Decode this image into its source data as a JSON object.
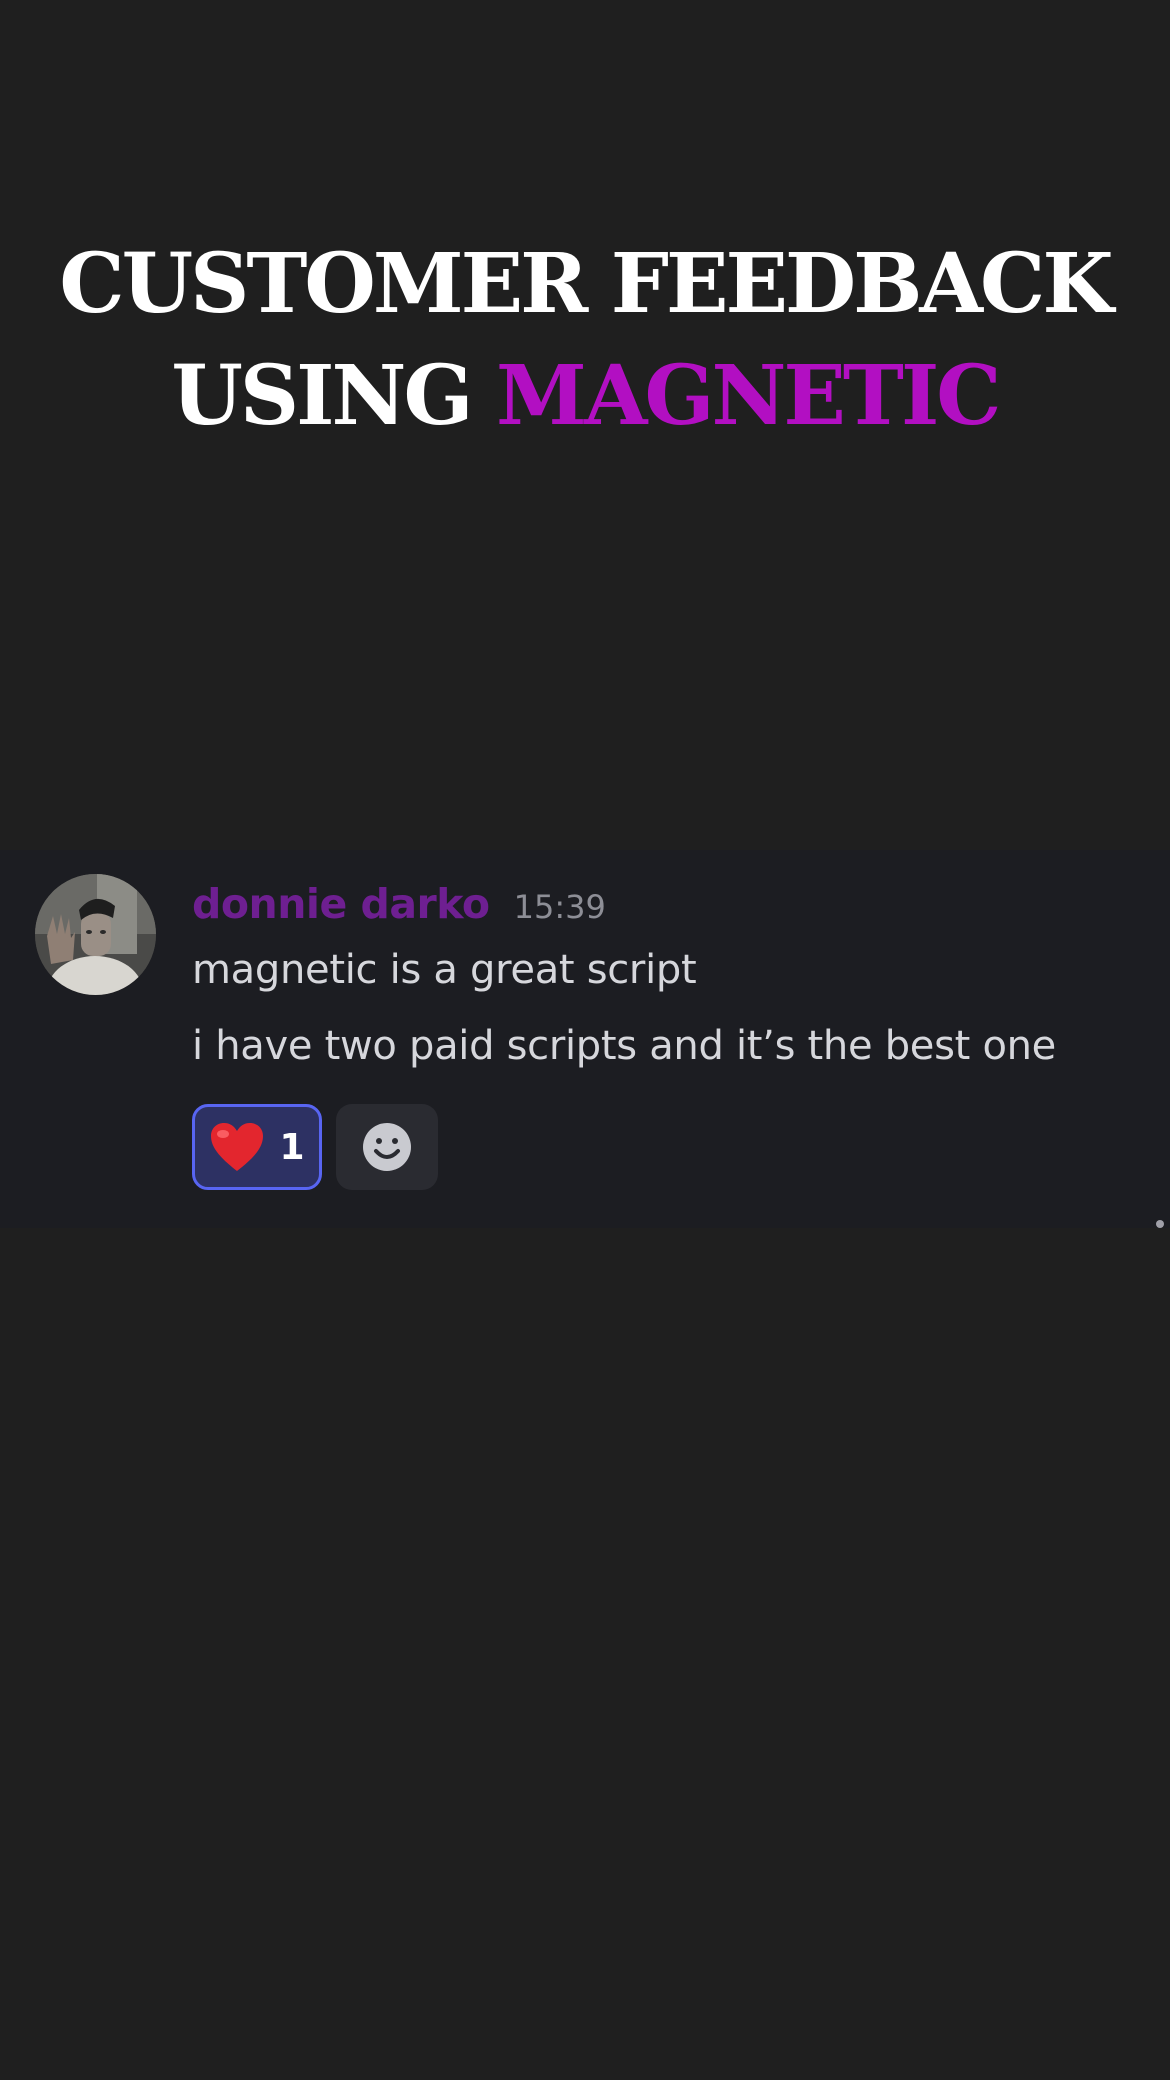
{
  "headline": {
    "line1": "CUSTOMER FEEDBACK",
    "line2_prefix": "USING ",
    "line2_accent": "MAGNETIC",
    "accent_color": "#b20fc2"
  },
  "message": {
    "username": "donnie darko",
    "username_color": "#6e1f91",
    "timestamp": "15:39",
    "lines": [
      "magnetic is a great script",
      "i have two paid scripts and it’s the best one"
    ],
    "avatar": "user-avatar-photo"
  },
  "reactions": [
    {
      "icon": "red-heart-icon",
      "count": "1",
      "selected": true
    },
    {
      "icon": "add-reaction-icon"
    }
  ]
}
